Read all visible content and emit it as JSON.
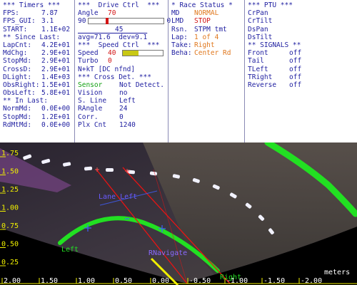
{
  "timers": {
    "header": "*** Timers ***",
    "fps": {
      "label": "FPS:",
      "value": "7.87"
    },
    "fps_gui": {
      "label": "FPS_GUI:",
      "value": "3.1"
    },
    "start": {
      "label": "START:",
      "value": "1.1E+02"
    },
    "since_last_header": "** Since Last:",
    "since_last": [
      {
        "label": "LapCnt:",
        "value": "4.2E+01"
      },
      {
        "label": "MdChg:",
        "value": "2.9E+01"
      },
      {
        "label": "StopMd:",
        "value": "2.9E+01"
      },
      {
        "label": "CrossD:",
        "value": "2.9E+01"
      },
      {
        "label": "DLight:",
        "value": "1.4E+03"
      },
      {
        "label": "ObsRight:",
        "value": "1.5E+01"
      },
      {
        "label": "ObsLeft:",
        "value": "5.8E+01"
      }
    ],
    "in_last_header": "** In Last:",
    "in_last": [
      {
        "label": "NormMd:",
        "value": "0.0E+00"
      },
      {
        "label": "StopMd:",
        "value": "1.2E+01"
      },
      {
        "label": "RdMtMd:",
        "value": "0.0E+00"
      }
    ]
  },
  "drive": {
    "header": "***  Drive Ctrl  ***",
    "angle_label": "Angle",
    "angle_value": "70",
    "slider_min": "90",
    "slider_max": "0",
    "slider_level": 0.22,
    "slider_value": "45",
    "avg_line": "avg=71.6  dev=9.1",
    "speed_header": "***  Speed Ctrl  ***",
    "speed_label": "Speed",
    "speed_value": "40",
    "speed_level": 0.4,
    "turbo_label": "Turbo",
    "turbo_value": "0",
    "nxt_line": "N+kT [DC nfnd]",
    "cross_header": "*** Cross Det. ***",
    "cross": [
      {
        "label": "Sensor",
        "value": "Not Detect."
      },
      {
        "label": "Vision",
        "value": "no"
      },
      {
        "label": "S. Line",
        "value": "Left"
      },
      {
        "label": "RAngle",
        "value": "24"
      },
      {
        "label": "Corr.",
        "value": "0"
      },
      {
        "label": "Plx Cnt",
        "value": "1240"
      }
    ]
  },
  "race": {
    "header": "* Race Status *",
    "rows": [
      {
        "label": "MD",
        "value": "NORMAL"
      },
      {
        "label": "LMD",
        "value": "STOP"
      },
      {
        "label": "Rsn.",
        "value": "STPM tmt"
      },
      {
        "label": "Lap:",
        "value": "1 of 4"
      },
      {
        "label": "Take:",
        "value": "Right"
      },
      {
        "label": "Beha:",
        "value": "Center Rd"
      }
    ]
  },
  "ptu": {
    "header": "*** PTU ***",
    "items": [
      "CrPan",
      "CrTilt",
      "DsPan",
      "DsTilt"
    ],
    "signals_header": "** SIGNALS **",
    "signals": [
      {
        "label": "Front",
        "value": "off"
      },
      {
        "label": "Tail",
        "value": "off"
      },
      {
        "label": "TLeft",
        "value": "off"
      },
      {
        "label": "TRight",
        "value": "off"
      },
      {
        "label": "Reverse",
        "value": "off"
      }
    ]
  },
  "view": {
    "y_ticks": [
      "1.75",
      "1.50",
      "1.25",
      "1.00",
      "0.75",
      "0.50",
      "0.25"
    ],
    "x_ticks": [
      "2.00",
      "1.50",
      "1.00",
      "0.50",
      "0.00",
      "-0.50",
      "-1.00",
      "-1.50",
      "-2.00"
    ],
    "units": "meters",
    "label_left": "Left",
    "label_right": "Right",
    "label_lane_left": "Lane Left",
    "label_rnavigate": "RNavigate"
  },
  "colors": {
    "accent_blue": "#1e1ea0",
    "warn_red": "#d21414",
    "status_orange": "#e0781e",
    "ok_green": "#12a012",
    "track_green": "#22e022",
    "axis_yellow": "#f0f000"
  }
}
